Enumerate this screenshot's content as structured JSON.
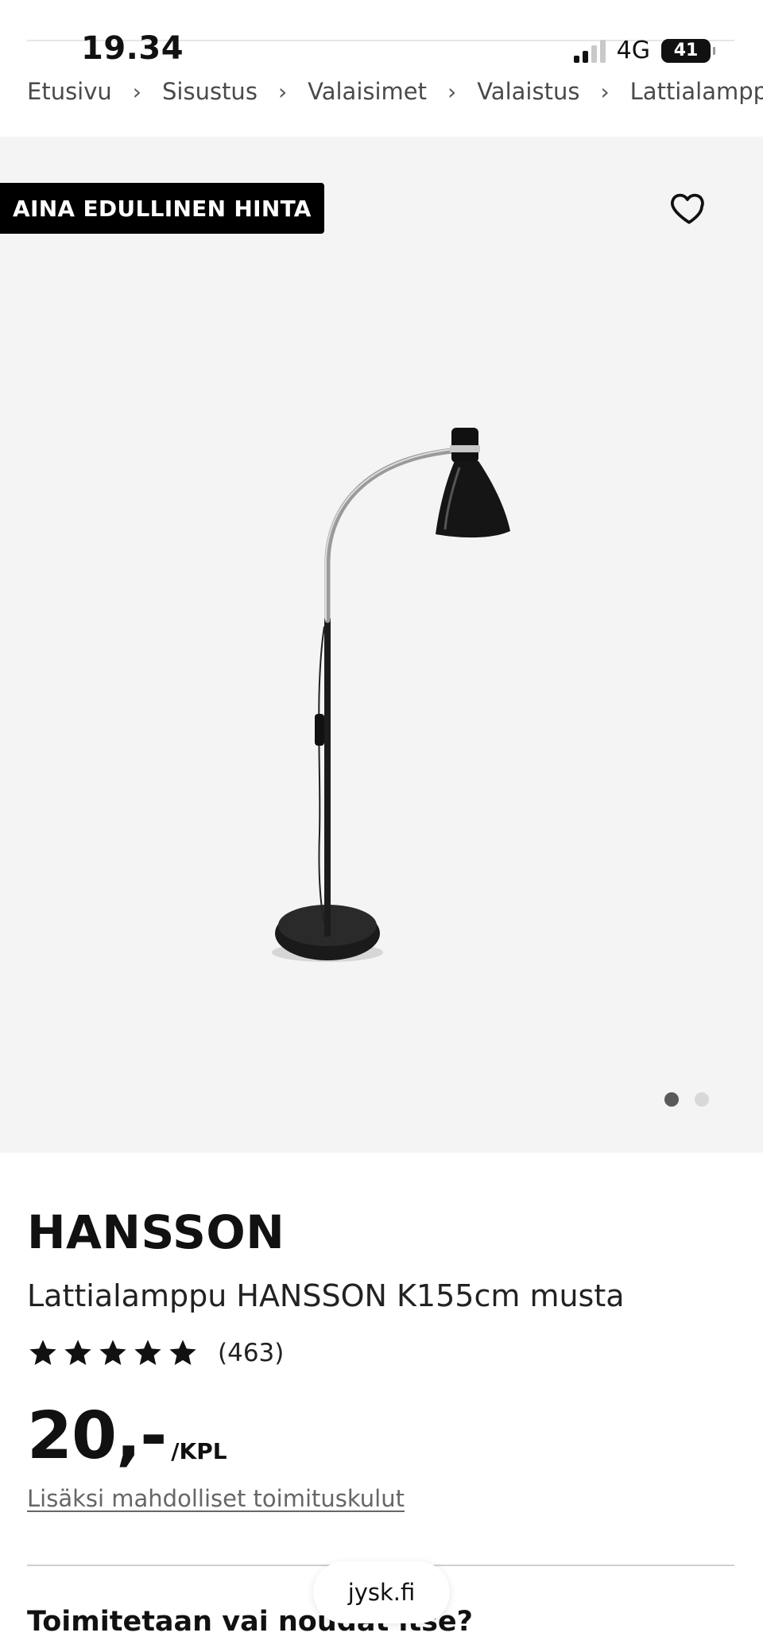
{
  "status_bar": {
    "time": "19.34",
    "network": "4G",
    "battery": "41",
    "icons": [
      "signal-icon",
      "battery-icon"
    ]
  },
  "breadcrumb": [
    {
      "label": "Etusivu"
    },
    {
      "label": "Sisustus"
    },
    {
      "label": "Valaisimet"
    },
    {
      "label": "Valaistus"
    },
    {
      "label": "Lattialamppu"
    }
  ],
  "breadcrumb_separator": "›",
  "hero": {
    "badge": "AINA EDULLINEN HINTA",
    "wishlist_icon": "heart-outline-icon",
    "image_alt_icon": "floor-lamp-image",
    "gallery": {
      "total": 2,
      "active_index": 0
    }
  },
  "product": {
    "brand": "HANSSON",
    "name": "Lattialamppu HANSSON K155cm musta",
    "rating": {
      "stars": 5,
      "max": 5,
      "count_label": "(463)"
    },
    "price": {
      "value": "20,-",
      "unit": "/KPL"
    },
    "shipping_note": "Lisäksi mahdolliset toimituskulut"
  },
  "delivery": {
    "heading": "Toimitetaan vai noudat itse?"
  },
  "browser": {
    "url": "jysk.fi"
  },
  "colors": {
    "badge_bg": "#000000",
    "hero_bg": "#f4f4f4",
    "text": "#111111",
    "muted": "#666666"
  }
}
